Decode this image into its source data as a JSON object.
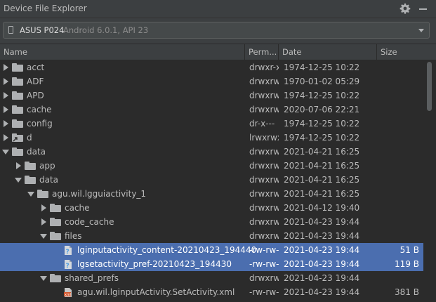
{
  "title": "Device File Explorer",
  "device": {
    "name": "ASUS P024",
    "detail": "Android 6.0.1, API 23"
  },
  "headers": {
    "name": "Name",
    "perm": "Perm...",
    "date": "Date",
    "size": "Size"
  },
  "rows": [
    {
      "name": "acct",
      "icon": "folder",
      "expand": "collapsed",
      "depth": 0,
      "perm": "drwxr-x",
      "date": "1974-12-25 10:22",
      "size": ""
    },
    {
      "name": "ADF",
      "icon": "folder",
      "expand": "collapsed",
      "depth": 0,
      "perm": "drwxrw:",
      "date": "1970-01-02 05:29",
      "size": ""
    },
    {
      "name": "APD",
      "icon": "folder",
      "expand": "collapsed",
      "depth": 0,
      "perm": "drwxrw:",
      "date": "1974-12-25 10:22",
      "size": ""
    },
    {
      "name": "cache",
      "icon": "folder",
      "expand": "collapsed",
      "depth": 0,
      "perm": "drwxrw:",
      "date": "2020-07-06 22:21",
      "size": ""
    },
    {
      "name": "config",
      "icon": "folder",
      "expand": "collapsed",
      "depth": 0,
      "perm": "dr-x---",
      "date": "1974-12-25 10:22",
      "size": ""
    },
    {
      "name": "d",
      "icon": "folder-link",
      "expand": "collapsed",
      "depth": 0,
      "perm": "lrwxrwx",
      "date": "1974-12-25 10:22",
      "size": ""
    },
    {
      "name": "data",
      "icon": "folder",
      "expand": "expanded",
      "depth": 0,
      "perm": "drwxrw:",
      "date": "2021-04-21 16:25",
      "size": ""
    },
    {
      "name": "app",
      "icon": "folder",
      "expand": "collapsed",
      "depth": 1,
      "perm": "drwxrw:",
      "date": "2021-04-21 16:25",
      "size": ""
    },
    {
      "name": "data",
      "icon": "folder",
      "expand": "expanded",
      "depth": 1,
      "perm": "drwxrw:",
      "date": "2021-04-21 16:25",
      "size": ""
    },
    {
      "name": "agu.wil.lgguiactivity_1",
      "icon": "folder",
      "expand": "expanded",
      "depth": 2,
      "perm": "drwxrw:",
      "date": "2021-04-21 16:25",
      "size": ""
    },
    {
      "name": "cache",
      "icon": "folder",
      "expand": "collapsed",
      "depth": 3,
      "perm": "drwxrw:",
      "date": "2021-04-12 19:40",
      "size": ""
    },
    {
      "name": "code_cache",
      "icon": "folder",
      "expand": "collapsed",
      "depth": 3,
      "perm": "drwxrw:",
      "date": "2021-04-23 19:44",
      "size": ""
    },
    {
      "name": "files",
      "icon": "folder",
      "expand": "expanded",
      "depth": 3,
      "perm": "drwxrw:",
      "date": "2021-04-23 19:44",
      "size": ""
    },
    {
      "name": "lginputactivity_content-20210423_194440",
      "icon": "unknown-file",
      "expand": "none",
      "depth": 4,
      "perm": "-rw-rw-",
      "date": "2021-04-23 19:44",
      "size": "51 B",
      "selected": true
    },
    {
      "name": "lgsetactivity_pref-20210423_194430",
      "icon": "unknown-file",
      "expand": "none",
      "depth": 4,
      "perm": "-rw-rw-",
      "date": "2021-04-23 19:44",
      "size": "119 B",
      "selected": true
    },
    {
      "name": "shared_prefs",
      "icon": "folder",
      "expand": "expanded",
      "depth": 3,
      "perm": "drwxrw:",
      "date": "2021-04-23 19:44",
      "size": ""
    },
    {
      "name": "agu.wil.lginputActivity.SetActivity.xml",
      "icon": "xml-file",
      "expand": "none",
      "depth": 4,
      "perm": "-rw-rw-",
      "date": "2021-04-23 19:44",
      "size": "381 B"
    }
  ],
  "colors": {
    "selection": "#4b6eaf",
    "background": "#2b2b2b",
    "panel": "#3c3f41",
    "xml_icon": "#d3552b",
    "unknown_icon": "#4f9ee3"
  }
}
